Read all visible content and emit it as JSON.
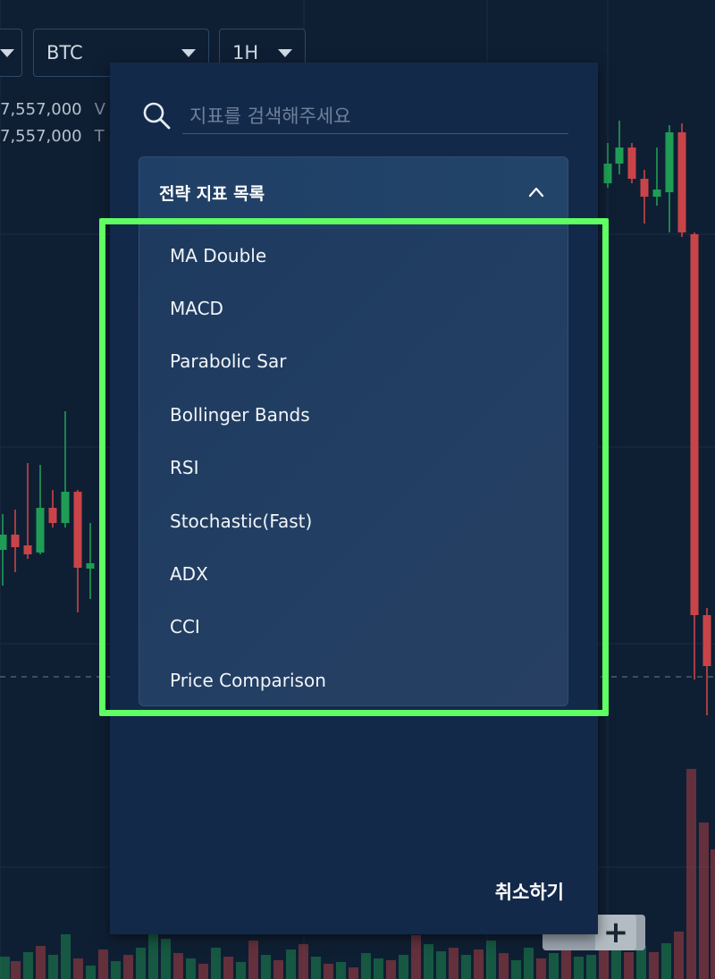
{
  "toolbar": {
    "market_select": "BTC",
    "interval_select": "1H"
  },
  "price_info": [
    {
      "value": "7,557,000",
      "suffix": "V"
    },
    {
      "value": "7,557,000",
      "suffix": "T"
    }
  ],
  "colors": {
    "background": "#0f1f33",
    "panel": "#13294a",
    "up_candle": "#1f9d55",
    "down_candle": "#c94448",
    "highlight": "#5fff63"
  },
  "indicator_panel": {
    "search_placeholder": "지표를 검색해주세요",
    "list_title": "전략 지표 목록",
    "items": [
      "MA Double",
      "MACD",
      "Parabolic Sar",
      "Bollinger Bands",
      "RSI",
      "Stochastic(Fast)",
      "ADX",
      "CCI",
      "Price Comparison"
    ],
    "cancel_label": "취소하기"
  },
  "icons": {
    "search": "search-icon",
    "collapse": "chevron-up-icon",
    "add": "plus-icon"
  }
}
